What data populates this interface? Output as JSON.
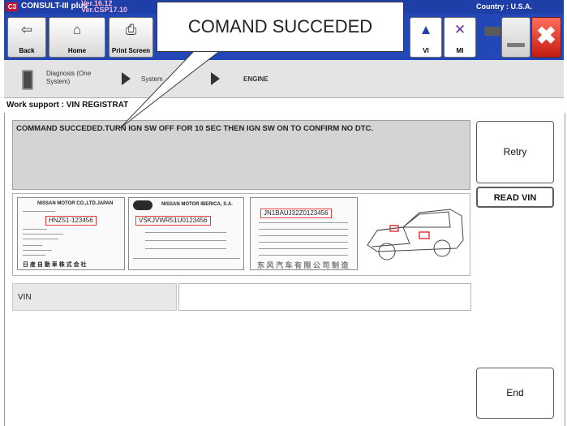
{
  "titlebar": {
    "app_name": "CONSULT-III plus",
    "version_line1": "Ver.16.12",
    "version_line2": "Ver.CSP17.10",
    "country": "Country : U.S.A.",
    "logo_text": "C3"
  },
  "toolbar": {
    "back_label": "Back",
    "home_label": "Home",
    "print_label": "Print Screen",
    "vi_label": "VI",
    "mi_label": "MI",
    "icons": {
      "back": "back-arrow-icon",
      "home": "home-icon",
      "print": "printer-icon",
      "vi": "signal-icon",
      "mi": "x-mark-icon",
      "battery": "battery-icon",
      "minimize": "minimize-icon",
      "close": "close-icon"
    }
  },
  "breadcrumb": {
    "diagnosis": "Diagnosis (One System)",
    "system": "System",
    "engine": "ENGINE"
  },
  "work_support": {
    "title": "Work support : VIN REGISTRAT"
  },
  "message": "COMMAND SUCCEDED.TURN IGN SW OFF FOR 10 SEC THEN IGN SW ON TO CONFIRM NO DTC.",
  "buttons": {
    "retry": "Retry",
    "read_vin": "READ VIN",
    "end": "End"
  },
  "labels": {
    "japan_header": "NISSAN MOTOR CO.,LTD.JAPAN",
    "japan_vin": "HNZ51-123456",
    "japan_footer": "日 産 自 動 車 株 式 会 社",
    "iberica_header": "NISSAN MOTOR IBERICA, S.A.",
    "iberica_vin": "VSKJVWR51U0123456",
    "china_vin": "JN1BAUJ32Z0123456",
    "china_footer": "东 风 汽 车 有 限 公 司 制 造"
  },
  "vin": {
    "label": "VIN",
    "value": ""
  },
  "callout": {
    "text": "COMAND SUCCEDED"
  },
  "colors": {
    "titlebar": "#1f3fa8",
    "toolbar": "#2447b8",
    "version_text": "#ffb7d5",
    "close_button": "#d9271a",
    "message_bg": "#d4d4d4",
    "vin_highlight": "#e23b3b"
  }
}
